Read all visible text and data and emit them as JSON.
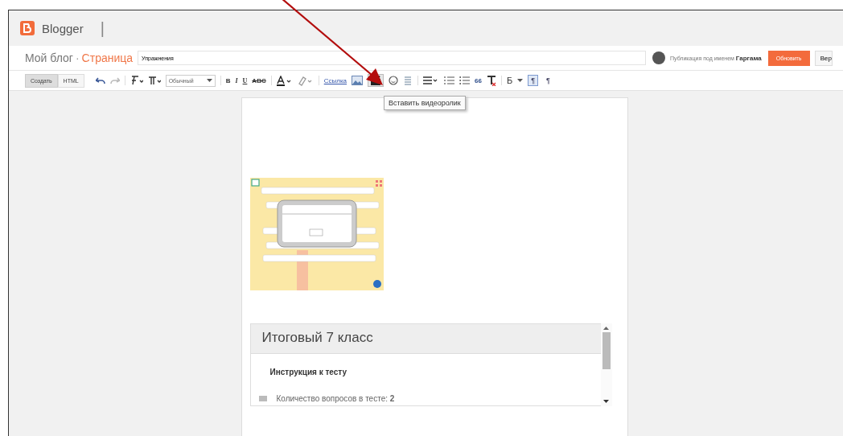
{
  "app": {
    "name": "Blogger",
    "separator": "|"
  },
  "title_bar": {
    "blog": "Мой блог",
    "dash": "·",
    "section": "Страница",
    "title_field": "Упражнения",
    "author_label": "Публикация под именем",
    "author": "Гаргама",
    "update_button": "Обновить",
    "next_button": "Вер"
  },
  "toolbar": {
    "modes": [
      {
        "label": "Создать",
        "selected": true
      },
      {
        "label": "HTML",
        "selected": false
      }
    ],
    "format_select": "Обычный",
    "bold": "B",
    "italic": "I",
    "underline": "U",
    "strike": "ABC",
    "link": "Ссылка",
    "quote": "66",
    "language": "Б",
    "direction": [
      {
        "label": "¶",
        "selected": true
      },
      {
        "label": "¶",
        "selected": false
      }
    ]
  },
  "tooltip": "Вставить видеоролик",
  "quiz": {
    "title": "Итоговый 7 класс",
    "instruction": "Инструкция к тесту",
    "question_count": "Количество вопросов в тесте: **2**"
  }
}
